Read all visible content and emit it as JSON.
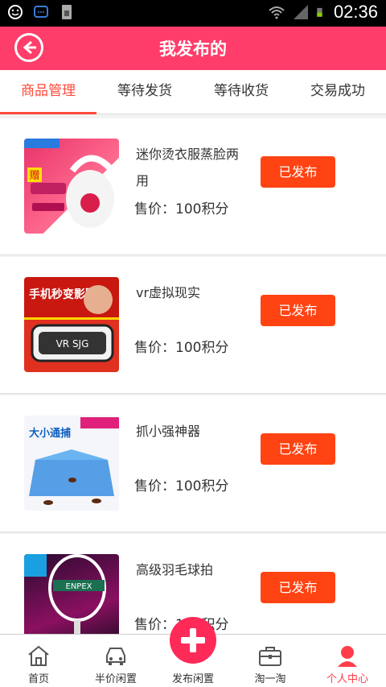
{
  "status_bar": {
    "time": "02:36"
  },
  "header": {
    "title": "我发布的"
  },
  "tabs": [
    {
      "label": "商品管理",
      "active": true
    },
    {
      "label": "等待发货",
      "active": false
    },
    {
      "label": "等待收货",
      "active": false
    },
    {
      "label": "交易成功",
      "active": false
    }
  ],
  "items": [
    {
      "name": "迷你烫衣服蒸脸两用",
      "price": "售价：100积分",
      "button": "已发布",
      "thumb_text": "赠"
    },
    {
      "name": "vr虚拟现实",
      "price": "售价：100积分",
      "button": "已发布",
      "thumb_text": "手机秒变影院"
    },
    {
      "name": "抓小强神器",
      "price": "售价：100积分",
      "button": "已发布",
      "thumb_text": "大小通捕"
    },
    {
      "name": "高级羽毛球拍",
      "price": "售价：100积分",
      "button": "已发布",
      "thumb_text": "ENPEX"
    }
  ],
  "bottom_nav": [
    {
      "label": "首页",
      "icon": "home-icon"
    },
    {
      "label": "半价闲置",
      "icon": "car-icon"
    },
    {
      "label": "发布闲置",
      "icon": "plus-icon"
    },
    {
      "label": "淘一淘",
      "icon": "briefcase-icon"
    },
    {
      "label": "个人中心",
      "icon": "person-icon",
      "active": true
    }
  ],
  "colors": {
    "accent": "#ff3d6a",
    "button": "#ff4313",
    "tab_active": "#ff4a3a"
  }
}
